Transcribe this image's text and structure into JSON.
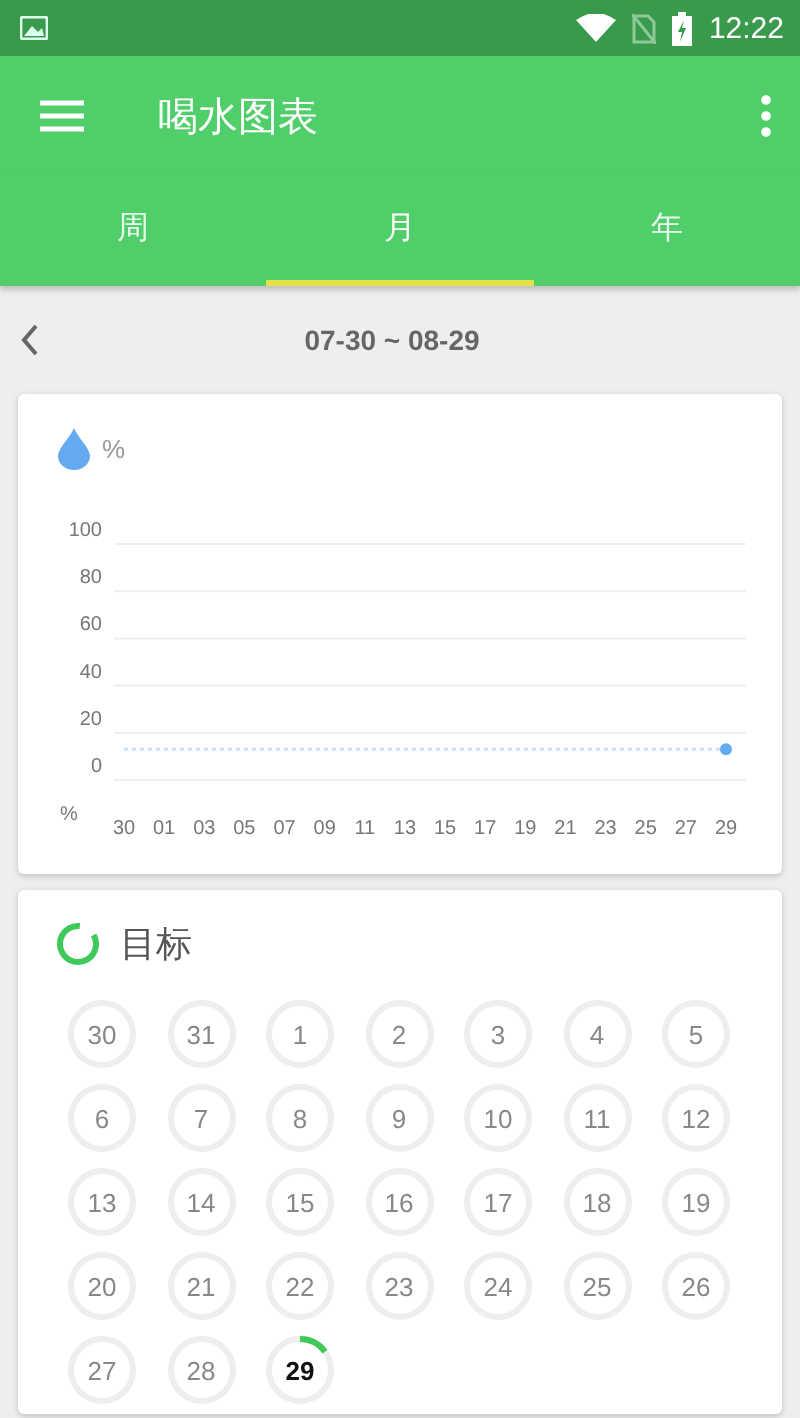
{
  "status_bar": {
    "time": "12:22"
  },
  "toolbar": {
    "title": "喝水图表"
  },
  "tabs": [
    {
      "label": "周",
      "selected": false
    },
    {
      "label": "月",
      "selected": true
    },
    {
      "label": "年",
      "selected": false
    }
  ],
  "date_range": "07-30 ~ 08-29",
  "chart_card": {
    "chart_data": {
      "type": "line",
      "ylabel": "%",
      "grid": true,
      "categories": [
        "30",
        "01",
        "03",
        "05",
        "07",
        "09",
        "11",
        "13",
        "15",
        "17",
        "19",
        "21",
        "23",
        "25",
        "27",
        "29"
      ],
      "series": [
        {
          "name": "%",
          "color": "#64aaf0",
          "marker": true,
          "line_style": "dotted",
          "values": [
            13,
            13,
            13,
            13,
            13,
            13,
            13,
            13,
            13,
            13,
            13,
            13,
            13,
            13,
            13,
            13
          ]
        }
      ],
      "ylim": [
        0,
        100
      ],
      "yticks": [
        0,
        20,
        40,
        60,
        80,
        100
      ]
    }
  },
  "goal_card": {
    "title": "目标",
    "days": [
      {
        "label": "30",
        "today": false
      },
      {
        "label": "31",
        "today": false
      },
      {
        "label": "1",
        "today": false
      },
      {
        "label": "2",
        "today": false
      },
      {
        "label": "3",
        "today": false
      },
      {
        "label": "4",
        "today": false
      },
      {
        "label": "5",
        "today": false
      },
      {
        "label": "6",
        "today": false
      },
      {
        "label": "7",
        "today": false
      },
      {
        "label": "8",
        "today": false
      },
      {
        "label": "9",
        "today": false
      },
      {
        "label": "10",
        "today": false
      },
      {
        "label": "11",
        "today": false
      },
      {
        "label": "12",
        "today": false
      },
      {
        "label": "13",
        "today": false
      },
      {
        "label": "14",
        "today": false
      },
      {
        "label": "15",
        "today": false
      },
      {
        "label": "16",
        "today": false
      },
      {
        "label": "17",
        "today": false
      },
      {
        "label": "18",
        "today": false
      },
      {
        "label": "19",
        "today": false
      },
      {
        "label": "20",
        "today": false
      },
      {
        "label": "21",
        "today": false
      },
      {
        "label": "22",
        "today": false
      },
      {
        "label": "23",
        "today": false
      },
      {
        "label": "24",
        "today": false
      },
      {
        "label": "25",
        "today": false
      },
      {
        "label": "26",
        "today": false
      },
      {
        "label": "27",
        "today": false
      },
      {
        "label": "28",
        "today": false
      },
      {
        "label": "29",
        "today": true
      }
    ]
  }
}
